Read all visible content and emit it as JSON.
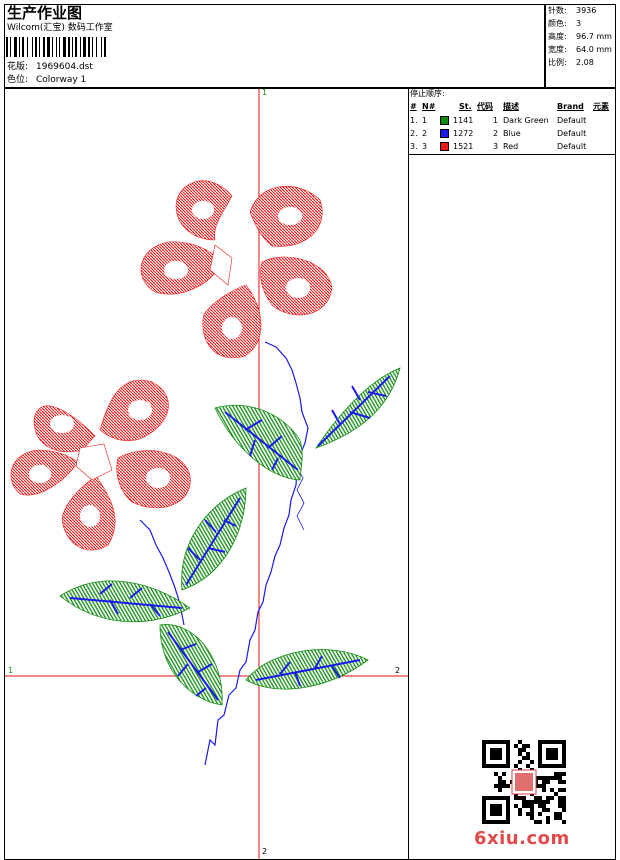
{
  "header": {
    "title": "生产作业图",
    "company": "Wilcom(汇宝) 数码工作室",
    "design_label": "花版:",
    "design_value": "1969604.dst",
    "colorway_label": "色位:",
    "colorway_value": "Colorway 1"
  },
  "stats": {
    "stitches_label": "针数:",
    "stitches_value": "3936",
    "colors_label": "颜色:",
    "colors_value": "3",
    "height_label": "高度:",
    "height_value": "96.7 mm",
    "width_label": "宽度:",
    "width_value": "64.0 mm",
    "ratio_label": "比例:",
    "ratio_value": "2.08"
  },
  "stop_sequence": {
    "title": "停止顺序:",
    "headers": {
      "num": "#",
      "no": "N#",
      "st": "St.",
      "code": "代码",
      "desc": "描述",
      "brand": "Brand",
      "elements": "元素"
    },
    "rows": [
      {
        "num": "1.",
        "no": "1",
        "color": "#108a10",
        "st": "1141",
        "code": "1",
        "desc": "Dark Green",
        "brand": "Default"
      },
      {
        "num": "2.",
        "no": "2",
        "color": "#1a1aee",
        "st": "1272",
        "code": "2",
        "desc": "Blue",
        "brand": "Default"
      },
      {
        "num": "3.",
        "no": "3",
        "color": "#ee1a1a",
        "st": "1521",
        "code": "3",
        "desc": "Red",
        "brand": "Default"
      }
    ]
  },
  "axes": {
    "top": "1",
    "left": "1",
    "right": "2",
    "bottom": "2"
  },
  "watermark": "6xiu.com",
  "colors": {
    "green": "#108a10",
    "blue": "#1a1aee",
    "red": "#ee1a1a",
    "axis": "#e01010"
  }
}
